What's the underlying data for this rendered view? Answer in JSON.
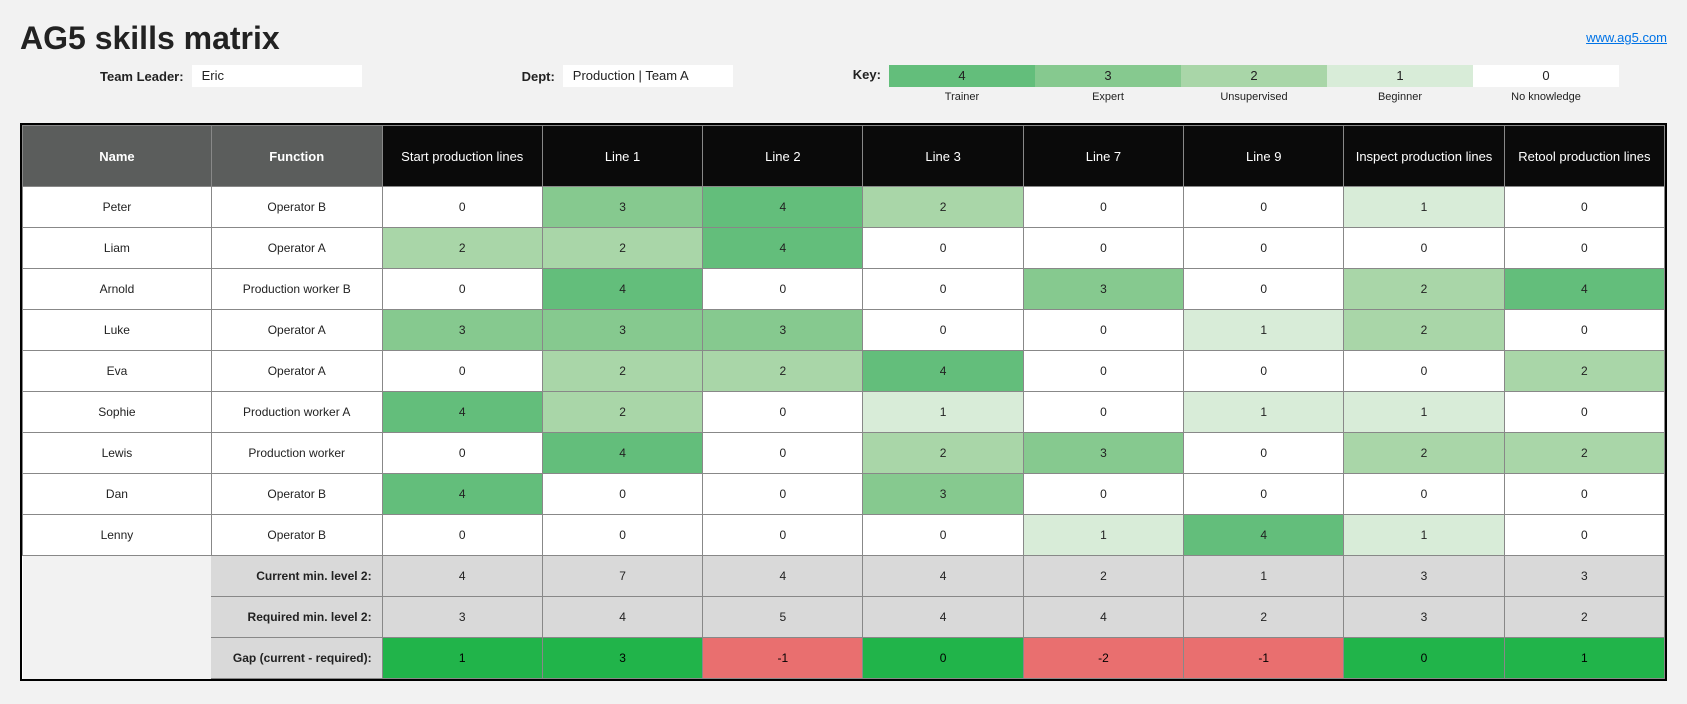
{
  "title": "AG5 skills matrix",
  "link_text": "www.ag5.com",
  "meta": {
    "team_leader_label": "Team Leader:",
    "team_leader_value": "Eric",
    "dept_label": "Dept:",
    "dept_value": "Production | Team A",
    "key_label": "Key:"
  },
  "key_levels": [
    {
      "n": "4",
      "label": "Trainer",
      "color": "#63be7b"
    },
    {
      "n": "3",
      "label": "Expert",
      "color": "#86c98f"
    },
    {
      "n": "2",
      "label": "Unsupervised",
      "color": "#a9d6a8"
    },
    {
      "n": "1",
      "label": "Beginner",
      "color": "#d8ecd8"
    },
    {
      "n": "0",
      "label": "No knowledge",
      "color": "#ffffff"
    }
  ],
  "columns": {
    "name": "Name",
    "function": "Function",
    "skills": [
      "Start production lines",
      "Line 1",
      "Line 2",
      "Line 3",
      "Line 7",
      "Line 9",
      "Inspect production lines",
      "Retool production lines"
    ]
  },
  "rows": [
    {
      "name": "Peter",
      "function": "Operator B",
      "v": [
        0,
        3,
        4,
        2,
        0,
        0,
        1,
        0
      ]
    },
    {
      "name": "Liam",
      "function": "Operator A",
      "v": [
        2,
        2,
        4,
        0,
        0,
        0,
        0,
        0
      ]
    },
    {
      "name": "Arnold",
      "function": "Production worker B",
      "v": [
        0,
        4,
        0,
        0,
        3,
        0,
        2,
        4
      ]
    },
    {
      "name": "Luke",
      "function": "Operator A",
      "v": [
        3,
        3,
        3,
        0,
        0,
        1,
        2,
        0
      ]
    },
    {
      "name": "Eva",
      "function": "Operator A",
      "v": [
        0,
        2,
        2,
        4,
        0,
        0,
        0,
        2
      ]
    },
    {
      "name": "Sophie",
      "function": "Production worker A",
      "v": [
        4,
        2,
        0,
        1,
        0,
        1,
        1,
        0
      ]
    },
    {
      "name": "Lewis",
      "function": "Production worker",
      "v": [
        0,
        4,
        0,
        2,
        3,
        0,
        2,
        2
      ]
    },
    {
      "name": "Dan",
      "function": "Operator B",
      "v": [
        4,
        0,
        0,
        3,
        0,
        0,
        0,
        0
      ]
    },
    {
      "name": "Lenny",
      "function": "Operator B",
      "v": [
        0,
        0,
        0,
        0,
        1,
        4,
        1,
        0
      ]
    }
  ],
  "summary": {
    "current_label": "Current min. level 2:",
    "current": [
      4,
      7,
      4,
      4,
      2,
      1,
      3,
      3
    ],
    "required_label": "Required min. level 2:",
    "required": [
      3,
      4,
      5,
      4,
      4,
      2,
      3,
      2
    ],
    "gap_label": "Gap (current - required):",
    "gap": [
      1,
      3,
      -1,
      0,
      -2,
      -1,
      0,
      1
    ]
  },
  "chart_data": {
    "type": "table",
    "title": "AG5 skills matrix",
    "skill_columns": [
      "Start production lines",
      "Line 1",
      "Line 2",
      "Line 3",
      "Line 7",
      "Line 9",
      "Inspect production lines",
      "Retool production lines"
    ],
    "level_scale": {
      "0": "No knowledge",
      "1": "Beginner",
      "2": "Unsupervised",
      "3": "Expert",
      "4": "Trainer"
    },
    "people": [
      {
        "name": "Peter",
        "function": "Operator B",
        "levels": [
          0,
          3,
          4,
          2,
          0,
          0,
          1,
          0
        ]
      },
      {
        "name": "Liam",
        "function": "Operator A",
        "levels": [
          2,
          2,
          4,
          0,
          0,
          0,
          0,
          0
        ]
      },
      {
        "name": "Arnold",
        "function": "Production worker B",
        "levels": [
          0,
          4,
          0,
          0,
          3,
          0,
          2,
          4
        ]
      },
      {
        "name": "Luke",
        "function": "Operator A",
        "levels": [
          3,
          3,
          3,
          0,
          0,
          1,
          2,
          0
        ]
      },
      {
        "name": "Eva",
        "function": "Operator A",
        "levels": [
          0,
          2,
          2,
          4,
          0,
          0,
          0,
          2
        ]
      },
      {
        "name": "Sophie",
        "function": "Production worker A",
        "levels": [
          4,
          2,
          0,
          1,
          0,
          1,
          1,
          0
        ]
      },
      {
        "name": "Lewis",
        "function": "Production worker",
        "levels": [
          0,
          4,
          0,
          2,
          3,
          0,
          2,
          2
        ]
      },
      {
        "name": "Dan",
        "function": "Operator B",
        "levels": [
          4,
          0,
          0,
          3,
          0,
          0,
          0,
          0
        ]
      },
      {
        "name": "Lenny",
        "function": "Operator B",
        "levels": [
          0,
          0,
          0,
          0,
          1,
          4,
          1,
          0
        ]
      }
    ],
    "current_min_level2": [
      4,
      7,
      4,
      4,
      2,
      1,
      3,
      3
    ],
    "required_min_level2": [
      3,
      4,
      5,
      4,
      4,
      2,
      3,
      2
    ],
    "gap": [
      1,
      3,
      -1,
      0,
      -2,
      -1,
      0,
      1
    ]
  }
}
